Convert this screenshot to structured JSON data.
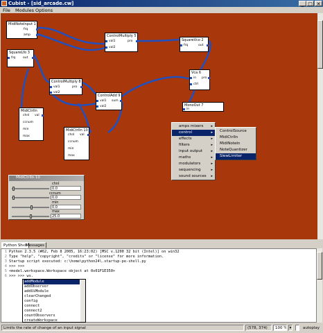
{
  "window": {
    "title": "Cubist - [sid_arcade.cw]"
  },
  "menu": [
    "File",
    "Modules",
    "Options"
  ],
  "nodes": {
    "midinoteinput": {
      "title": "MidiNoteInput 1",
      "ports": [
        "frq",
        "amp"
      ]
    },
    "controlmultiply5": {
      "title": "ControlMultiply 5",
      "ports": [
        "val1",
        "val2",
        "pro"
      ]
    },
    "squarevco2": {
      "title": "SquareVco 2",
      "ports": [
        "frq",
        "out"
      ]
    },
    "squarelfo3": {
      "title": "SquareLfo 3",
      "ports": [
        "frq",
        "out"
      ]
    },
    "controlmultiply8": {
      "title": "ControlMultiply 8",
      "ports": [
        "val1",
        "val2",
        "pro"
      ]
    },
    "vca6": {
      "title": "Vca 6",
      "ports": [
        "in",
        "ctrl",
        "pro"
      ]
    },
    "controladd": {
      "title": "ControlAdd 9",
      "ports": [
        "val1",
        "val2",
        "sum"
      ]
    },
    "monoout7": {
      "title": "MonoOut 7",
      "ports": [
        "in"
      ]
    },
    "midictrlin": {
      "title": "MidiCtrlIn",
      "ports": [
        "chnl",
        "val",
        "ccnum",
        "min",
        "max"
      ]
    },
    "midictrlin10": {
      "title": "MidiCtrlIn 10",
      "ports": [
        "chnl",
        "val",
        "ccnum",
        "min",
        "max"
      ]
    }
  },
  "context_menu": {
    "items": [
      "amps mixers",
      "control",
      "effects",
      "filters",
      "input output",
      "maths",
      "modulators",
      "sequencing",
      "sound sources"
    ],
    "selected": "control",
    "submenu": [
      "ControlSource",
      "MidiCtrlIn",
      "MidiNoteIn",
      "NoteQuantizer",
      "SlewLimiter"
    ],
    "submenu_selected": "SlewLimiter"
  },
  "midictrl_panel": {
    "title": "MidiCtrlIn 10",
    "rows": [
      {
        "label": "chnl",
        "value": "0.0"
      },
      {
        "label": "ccnum",
        "value": "0.0"
      },
      {
        "label": "min",
        "value": "0.0"
      },
      {
        "label": "max",
        "value": "25.0"
      }
    ]
  },
  "tabs": [
    "Python Shell",
    "Messages"
  ],
  "shell_lines": [
    "Python 2.3.5 (#62, Feb  8 2005, 16:23:02) [MSC v.1200 32 bit (Intel)] on win32",
    "Type \"help\", \"copyright\", \"credits\" or \"license\" for more information.",
    "Startup script executed: c:\\home\\python24\\.startup-pe-shell.py",
    ">>> >>>",
    "<model.workspace.Workspace object at 0x01F1E350>",
    ">>> >>> ws."
  ],
  "autocomplete": [
    "addModule",
    "addObserver",
    "addUiModule",
    "clearChanged",
    "config",
    "connect",
    "connect2",
    "countObservers",
    "createWorkspace"
  ],
  "status": {
    "message": "Limits the rate of change of an input signal",
    "coords": "(578, 374)",
    "zoom": "100 %",
    "autoplay": "autoplay"
  }
}
